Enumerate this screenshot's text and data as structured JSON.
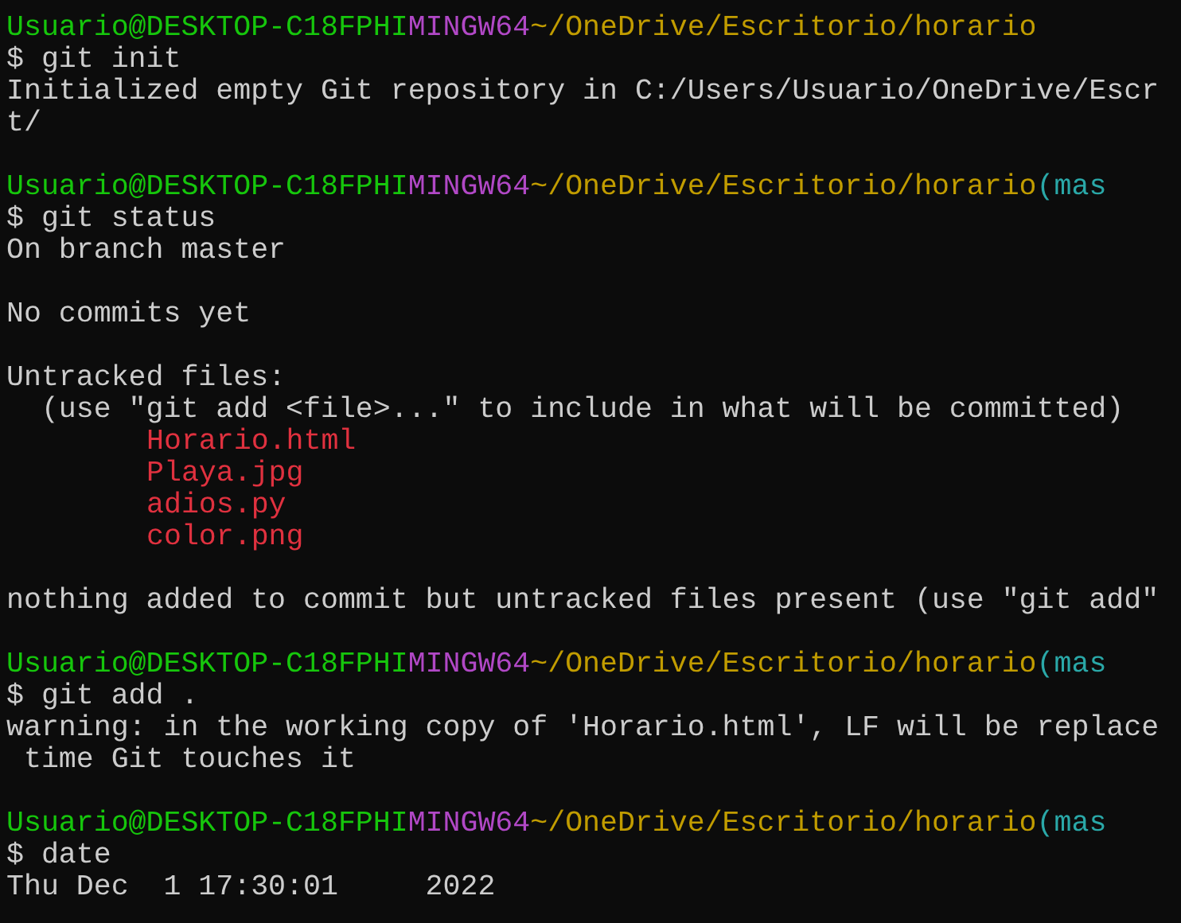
{
  "lines": [
    {
      "kind": "prompt",
      "user": "Usuario@DESKTOP-C18FPHI",
      "system": "MINGW64",
      "path": "~/OneDrive/Escritorio/horario"
    },
    {
      "kind": "command",
      "text": "$ git init"
    },
    {
      "kind": "output",
      "text": "Initialized empty Git repository in C:/Users/Usuario/OneDrive/Escr"
    },
    {
      "kind": "output",
      "text": "t/"
    },
    {
      "kind": "blank"
    },
    {
      "kind": "prompt",
      "user": "Usuario@DESKTOP-C18FPHI",
      "system": "MINGW64",
      "path": "~/OneDrive/Escritorio/horario",
      "branch": "(mas"
    },
    {
      "kind": "command",
      "text": "$ git status"
    },
    {
      "kind": "output",
      "text": "On branch master"
    },
    {
      "kind": "blank"
    },
    {
      "kind": "output",
      "text": "No commits yet"
    },
    {
      "kind": "blank"
    },
    {
      "kind": "output",
      "text": "Untracked files:"
    },
    {
      "kind": "output",
      "text": "  (use \"git add <file>...\" to include in what will be committed)"
    },
    {
      "kind": "file",
      "text": "Horario.html"
    },
    {
      "kind": "file",
      "text": "Playa.jpg"
    },
    {
      "kind": "file",
      "text": "adios.py"
    },
    {
      "kind": "file",
      "text": "color.png"
    },
    {
      "kind": "blank"
    },
    {
      "kind": "output",
      "text": "nothing added to commit but untracked files present (use \"git add\""
    },
    {
      "kind": "blank"
    },
    {
      "kind": "prompt",
      "user": "Usuario@DESKTOP-C18FPHI",
      "system": "MINGW64",
      "path": "~/OneDrive/Escritorio/horario",
      "branch": "(mas"
    },
    {
      "kind": "command",
      "text": "$ git add ."
    },
    {
      "kind": "output",
      "text": "warning: in the working copy of 'Horario.html', LF will be replace"
    },
    {
      "kind": "output",
      "text": " time Git touches it"
    },
    {
      "kind": "blank"
    },
    {
      "kind": "prompt",
      "user": "Usuario@DESKTOP-C18FPHI",
      "system": "MINGW64",
      "path": "~/OneDrive/Escritorio/horario",
      "branch": "(mas"
    },
    {
      "kind": "command",
      "text": "$ date"
    },
    {
      "kind": "output",
      "text": "Thu Dec  1 17:30:01     2022"
    }
  ]
}
